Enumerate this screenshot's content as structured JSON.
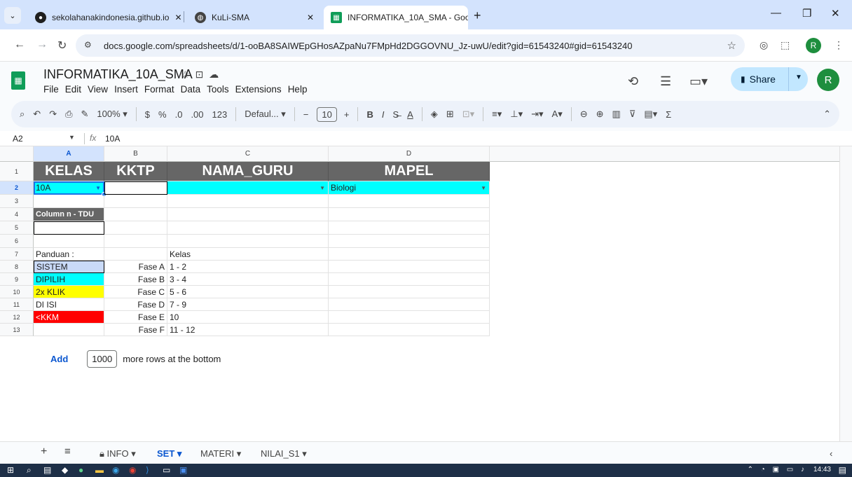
{
  "browser": {
    "tabs": [
      {
        "label": "sekolahanakindonesia.github.io",
        "icon": "github-icon"
      },
      {
        "label": "KuLi-SMA",
        "icon": "globe-icon"
      },
      {
        "label": "INFORMATIKA_10A_SMA - Goo",
        "icon": "sheets-icon"
      }
    ],
    "close_glyph": "✕",
    "new_tab": "+",
    "url": "docs.google.com/spreadsheets/d/1-ooBA8SAIWEpGHosAZpaNu7FMpHd2DGGOVNU_Jz-uwU/edit?gid=61543240#gid=61543240"
  },
  "doc": {
    "title": "INFORMATIKA_10A_SMA",
    "menu": [
      "File",
      "Edit",
      "View",
      "Insert",
      "Format",
      "Data",
      "Tools",
      "Extensions",
      "Help"
    ],
    "share_label": "Share",
    "avatar_letter": "R"
  },
  "toolbar": {
    "zoom": "100%",
    "currency": "$",
    "percent": "%",
    "dec_decrease": ".0",
    "dec_increase": ".00",
    "number_format": "123",
    "font": "Defaul...",
    "font_size": "10"
  },
  "formula": {
    "cell_ref": "A2",
    "fx": "fx",
    "value": "10A"
  },
  "grid": {
    "columns": [
      "A",
      "B",
      "C",
      "D"
    ],
    "rows": [
      "1",
      "2",
      "3",
      "4",
      "5",
      "6",
      "7",
      "8",
      "9",
      "10",
      "11",
      "12",
      "13"
    ],
    "header": {
      "a": "KELAS",
      "b": "KKTP",
      "c": "NAMA_GURU",
      "d": "MAPEL"
    },
    "row2": {
      "a": "10A",
      "d": "Biologi"
    },
    "a4": "Column n - TDU",
    "panduan_label": "Panduan :",
    "kelas_label": "Kelas",
    "legend": [
      {
        "label": "SISTEM",
        "color": "#c9daf8"
      },
      {
        "label": "DIPILIH",
        "color": "#00ffff"
      },
      {
        "label": "2x KLIK",
        "color": "#ffff00"
      },
      {
        "label": "DI ISI",
        "color": "#ffffff"
      },
      {
        "label": "<KKM",
        "color": "#ff0000"
      }
    ],
    "fases": [
      {
        "fase": "Fase A",
        "kelas": "1 - 2"
      },
      {
        "fase": "Fase B",
        "kelas": "3 - 4"
      },
      {
        "fase": "Fase C",
        "kelas": "5 - 6"
      },
      {
        "fase": "Fase D",
        "kelas": "7 - 9"
      },
      {
        "fase": "Fase E",
        "kelas": "10"
      },
      {
        "fase": "Fase F",
        "kelas": "11 - 12"
      }
    ]
  },
  "add_rows": {
    "button": "Add",
    "count": "1000",
    "suffix": "more rows at the bottom"
  },
  "sheets": {
    "add": "+",
    "all": "≡",
    "tabs": [
      {
        "label": "INFO",
        "locked": true
      },
      {
        "label": "SET",
        "active": true
      },
      {
        "label": "MATERI"
      },
      {
        "label": "NILAI_S1"
      }
    ]
  },
  "taskbar": {
    "time": "14:43"
  },
  "colors": {
    "accent": "#0b57d0",
    "header_fill": "#666666",
    "cyan": "#00ffff"
  }
}
